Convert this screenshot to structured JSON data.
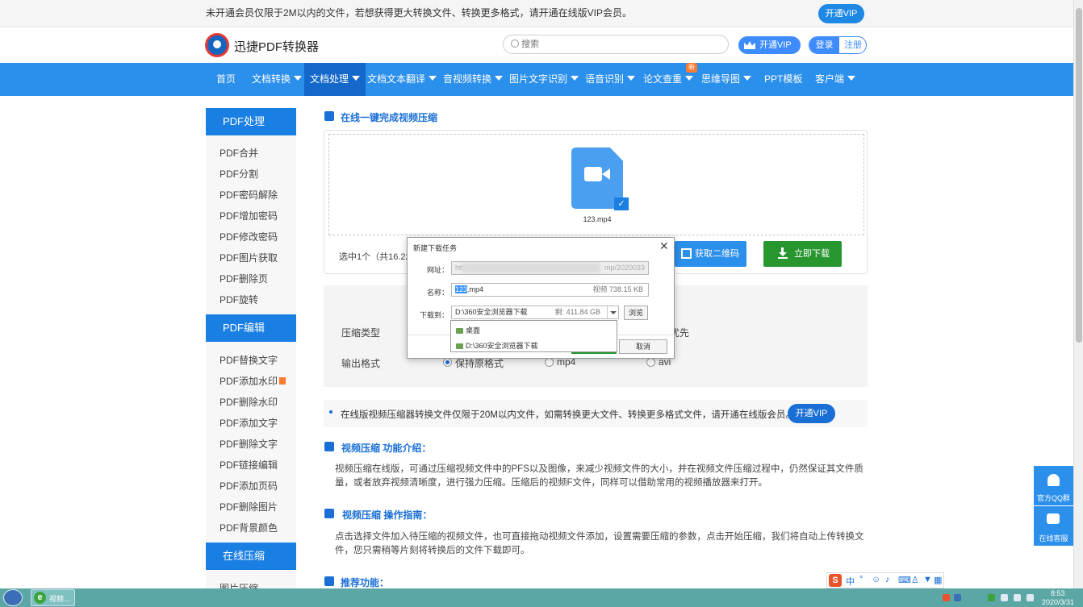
{
  "notice": {
    "text": "未开通会员仅限于2M以内的文件，若想获得更大转换文件、转换更多格式，请开通在线版VIP会员。",
    "vip_button": "开通VIP"
  },
  "header": {
    "logo_text": "迅捷PDF转换器",
    "search_placeholder": "搜索",
    "vip_button": "开通VIP",
    "login": "登录",
    "register": "注册"
  },
  "nav": {
    "items": [
      {
        "label": "首页"
      },
      {
        "label": "文档转换"
      },
      {
        "label": "文档处理"
      },
      {
        "label": "文档文本翻译"
      },
      {
        "label": "音视频转换"
      },
      {
        "label": "图片文字识别"
      },
      {
        "label": "语音识别"
      },
      {
        "label": "论文查重"
      },
      {
        "label": "思维导图"
      },
      {
        "label": "PPT模板"
      },
      {
        "label": "客户端"
      }
    ],
    "new_badge": "新"
  },
  "sidebar": {
    "sections": [
      {
        "title": "PDF处理",
        "items": [
          "PDF合并",
          "PDF分割",
          "PDF密码解除",
          "PDF增加密码",
          "PDF修改密码",
          "PDF图片获取",
          "PDF删除页",
          "PDF旋转"
        ]
      },
      {
        "title": "PDF编辑",
        "items": [
          "PDF替换文字",
          "PDF添加水印",
          "PDF删除水印",
          "PDF添加文字",
          "PDF删除文字",
          "PDF链接编辑",
          "PDF添加页码",
          "PDF删除图片",
          "PDF背景颜色"
        ]
      },
      {
        "title": "在线压缩",
        "items": [
          "图片压缩"
        ]
      }
    ]
  },
  "main": {
    "title": "在线一键完成视频压缩",
    "file_name": "123.mp4",
    "select_info": "选中1个（共16.22N",
    "qr_button": "获取二维码",
    "download_button": "立即下载",
    "compress_type_label": "压缩类型",
    "compress_option_partial": "优先",
    "output_format_label": "输出格式",
    "output_options": [
      "保持原格式",
      "mp4",
      "avi"
    ],
    "vip_tip": "在线版视频压缩器转换文件仅限于20M以内文件，如需转换更大文件、转换更多格式文件，请开通在线版会员。",
    "vip_tip_button": "开通VIP",
    "intro_title": "视频压缩 功能介绍：",
    "intro_text": "视频压缩在线版，可通过压缩视频文件中的PFS以及图像，来减少视频文件的大小，并在视频文件压缩过程中，仍然保证其文件质量，或者放弃视频清晰度，进行强力压缩。压缩后的视频F文件，同样可以借助常用的视频播放器来打开。",
    "guide_title": "视频压缩 操作指南：",
    "guide_text": "点击选择文件加入待压缩的视频文件，也可直接拖动视频文件添加，设置需要压缩的参数，点击开始压缩，我们将自动上传转换文件，您只需稍等片刻将转换后的文件下载即可。",
    "recommend_title": "推荐功能："
  },
  "dialog": {
    "title": "新建下载任务",
    "url_label": "网址：",
    "url_start": "htt",
    "url_end": "mp/2020033",
    "name_label": "名称：",
    "name_selected": "123",
    "name_rest": ".mp4",
    "name_size": "视频 738.15 KB",
    "dir_label": "下载到：",
    "dir_path": "D:\\360安全浏览器下载",
    "dir_free": "剩: 411.84 GB",
    "browse_button": "浏览",
    "cancel_button": "取消",
    "dropdown_options": [
      "桌面",
      "D:\\360安全浏览器下载"
    ]
  },
  "float": {
    "qq_label": "官方QQ群",
    "service_label": "在线客服"
  },
  "ime": {
    "logo": "S",
    "mode": "中"
  },
  "taskbar": {
    "app_label": "视频...",
    "time": "8:53",
    "date": "2020/3/31"
  },
  "colors": {
    "nav_blue": "#2b8fec",
    "nav_active": "#1468c9",
    "download_green": "#27962f",
    "taskbar": "#5aa7a5"
  }
}
